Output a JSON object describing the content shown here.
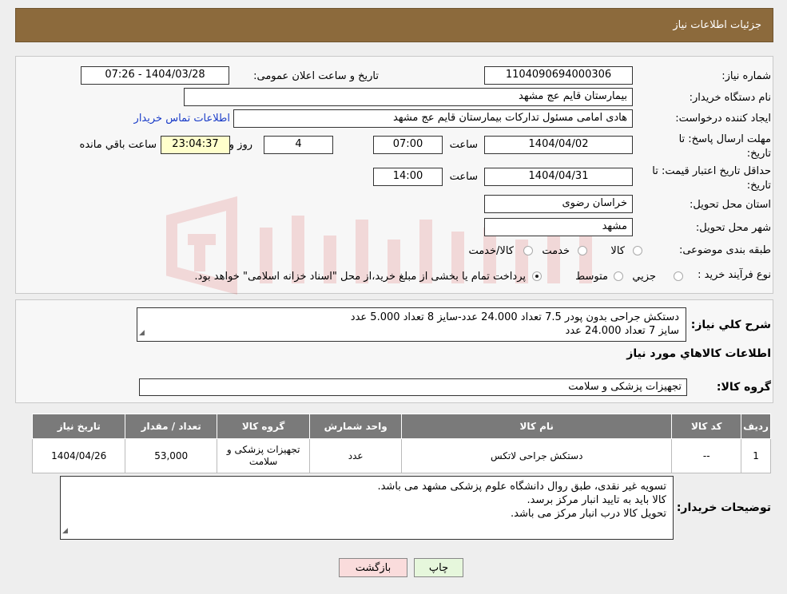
{
  "header": {
    "title": "جزئیات اطلاعات نیاز"
  },
  "form": {
    "need_number_label": "شماره نیاز:",
    "need_number": "1104090694000306",
    "announce_label": "تاریخ و ساعت اعلان عمومی:",
    "announce_value": "1404/03/28 - 07:26",
    "buyer_org_label": "نام دستگاه خریدار:",
    "buyer_org": "بیمارستان قایم  عج  مشهد",
    "creator_label": "ایجاد کننده درخواست:",
    "creator": "هادی امامی مسئول تدارکات بیمارستان قایم  عج  مشهد",
    "contact_link": "اطلاعات تماس خریدار",
    "deadline_label_1": "مهلت ارسال پاسخ: تا",
    "deadline_label_2": "تاریخ:",
    "deadline_date": "1404/04/02",
    "time_word": "ساعت",
    "deadline_time": "07:00",
    "days_value": "4",
    "days_word": "روز و",
    "remaining_time": "23:04:37",
    "remaining_word": "ساعت باقي مانده",
    "validity_label_1": "حداقل تاریخ اعتبار قیمت: تا",
    "validity_label_2": "تاریخ:",
    "validity_date": "1404/04/31",
    "validity_time": "14:00",
    "province_label": "استان محل تحویل:",
    "province": "خراسان رضوی",
    "city_label": "شهر محل تحویل:",
    "city": "مشهد",
    "category_label": "طبقه بندی موضوعی:",
    "category_options": [
      "کالا",
      "خدمت",
      "کالا/خدمت"
    ],
    "process_label": "نوع فرآیند خرید :",
    "process_options": [
      "جزیي",
      "متوسط"
    ],
    "process_note": "پرداخت تمام یا بخشی از مبلغ خرید،از محل \"اسناد خزانه اسلامی\" خواهد بود."
  },
  "description": {
    "label": "شرح كلي نياز:",
    "line1": "دستکش جراحی بدون پودر 7.5 تعداد 24.000 عدد-سایز 8 تعداد 5.000 عدد",
    "line2": "سایز 7 تعداد 24.000 عدد"
  },
  "goods": {
    "title": "اطلاعات كالاهاي مورد نياز",
    "group_label": "گروه كالا:",
    "group_value": "تجهیزات پزشکی و سلامت"
  },
  "table": {
    "headers": [
      "رديف",
      "كد كالا",
      "نام كالا",
      "واحد شمارش",
      "گروه كالا",
      "تعداد / مقدار",
      "تاريخ نياز"
    ],
    "rows": [
      [
        "1",
        "--",
        "دستکش جراحی لاتکس",
        "عدد",
        "تجهیزات پزشکی و سلامت",
        "53,000",
        "1404/04/26"
      ]
    ]
  },
  "buyer_notes": {
    "label": "توضيحات خريدار:",
    "line1": "تسویه غیر نقدی، طبق روال دانشگاه علوم پزشکی مشهد می باشد.",
    "line2": "کالا باید به تایید انبار مرکز برسد.",
    "line3": "تحویل کالا درب انبار مرکز می باشد."
  },
  "buttons": {
    "print": "چاپ",
    "back": "بازگشت"
  },
  "colors": {
    "header": "#8c6a3c",
    "print_button": "#e6f7dc",
    "back_button": "#fadcdc"
  }
}
